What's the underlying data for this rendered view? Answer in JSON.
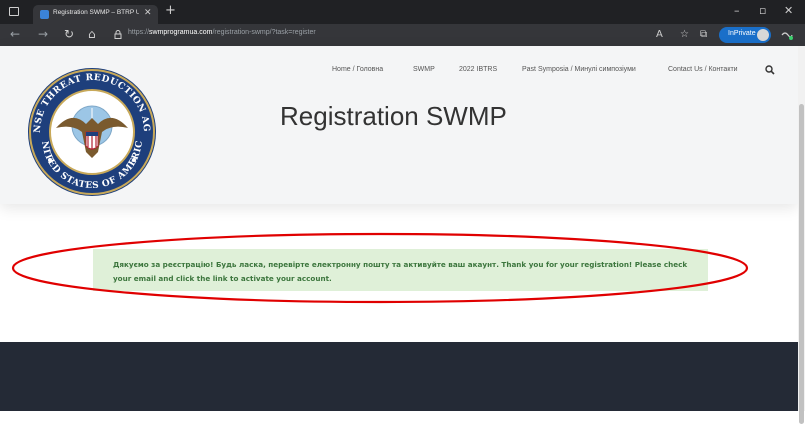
{
  "browser": {
    "tab_title": "Registration SWMP – BTRP Ukra",
    "url_prefix": "https://",
    "url_domain": "swmprogramua.com",
    "url_path": "/registration-swmp/?task=register",
    "inprivate_label": "InPrivate"
  },
  "nav": {
    "items": [
      {
        "label": "Home / Головна"
      },
      {
        "label": "SWMP"
      },
      {
        "label": "2022 IBTRS"
      },
      {
        "label": "Past Symposia / Минулі симпозіуми"
      },
      {
        "label": "Contact Us / Контакти"
      }
    ]
  },
  "seal": {
    "top_text": "DEFENSE THREAT REDUCTION AGENCY",
    "bottom_text": "UNITED STATES OF AMERICA"
  },
  "page": {
    "title": "Registration SWMP"
  },
  "alert": {
    "message": "Дякуємо за реєстрацію! Будь ласка, перевірте електронну пошту та активуйте ваш акаунт. Thank you for your registration! Please check your email and click the link to activate your account."
  },
  "colors": {
    "alert_bg": "#dff0d8",
    "alert_text": "#3c763d",
    "annotation": "#e00000",
    "footer": "#242a36",
    "inprivate": "#1a6fc9"
  }
}
